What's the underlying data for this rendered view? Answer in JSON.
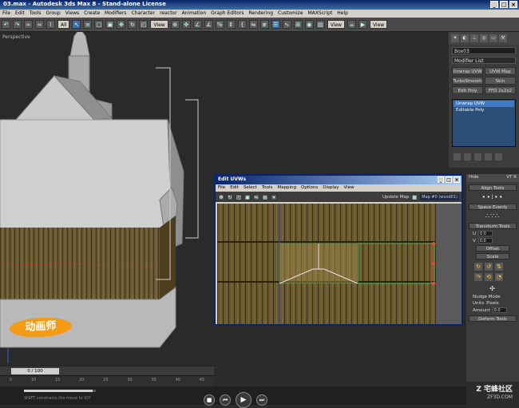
{
  "window": {
    "title": "03.max - Autodesk 3ds Max 8 - Stand-alone License"
  },
  "menu": [
    "File",
    "Edit",
    "Tools",
    "Group",
    "Views",
    "Create",
    "Modifiers",
    "Character",
    "reactor",
    "Animation",
    "Graph Editors",
    "Rendering",
    "Customize",
    "MAXScript",
    "Help"
  ],
  "toolbar": {
    "filter": "All",
    "refcoord": "View",
    "refcoord2": "View",
    "viewdrop": "View"
  },
  "viewport": {
    "label": "Perspective"
  },
  "command_panel": {
    "object_name": "Box03",
    "modifier_list": "Modifier List",
    "buttons": [
      "Unwrap UVW",
      "UVW Map",
      "TurboSmooth",
      "Skin",
      "Edit Poly",
      "FFD 2x2x2"
    ],
    "stack": [
      {
        "label": "Unwrap UVW",
        "selected": true
      },
      {
        "label": "Editable Poly",
        "selected": false
      }
    ]
  },
  "uv_editor": {
    "title": "Edit UVWs",
    "menu": [
      "File",
      "Edit",
      "Select",
      "Tools",
      "Mapping",
      "Options",
      "Display",
      "View"
    ],
    "update_map": "Update Map",
    "map_dropdown": "Map #0 (wood01)"
  },
  "right_lower": {
    "header_left": "Hide",
    "header_right": "VT R",
    "sections": {
      "align": "Align Tools",
      "space": "Space Evenly",
      "transform": "Transform Tools"
    },
    "fields": [
      {
        "label": "U",
        "value": "0.0"
      },
      {
        "label": "V",
        "value": "0.0"
      }
    ],
    "offset": "Offset",
    "scale": "Scale",
    "nudge_mode": "Nudge Mode",
    "units": "Units",
    "pixels": "Pixels",
    "amount_label": "Amount",
    "amount_value": "0.0",
    "deform": "Deform Tools"
  },
  "timeline": {
    "slider": "0 / 100",
    "ticks": [
      "0",
      "10",
      "15",
      "20",
      "25",
      "30",
      "35",
      "40",
      "45"
    ]
  },
  "status": {
    "hint": "SHIFT constrains the move to X/Y",
    "progress": 0.95
  },
  "logo_text": "动画师",
  "watermark": {
    "line1": "Z 宅蜂社区",
    "line2": "ZF3D.COM"
  },
  "colors": {
    "title": "#0a246a",
    "selection": "#3f79c4",
    "uv_green": "#3fa84f",
    "gizmo_red": "#e0512f",
    "logo": "#f39b12"
  }
}
